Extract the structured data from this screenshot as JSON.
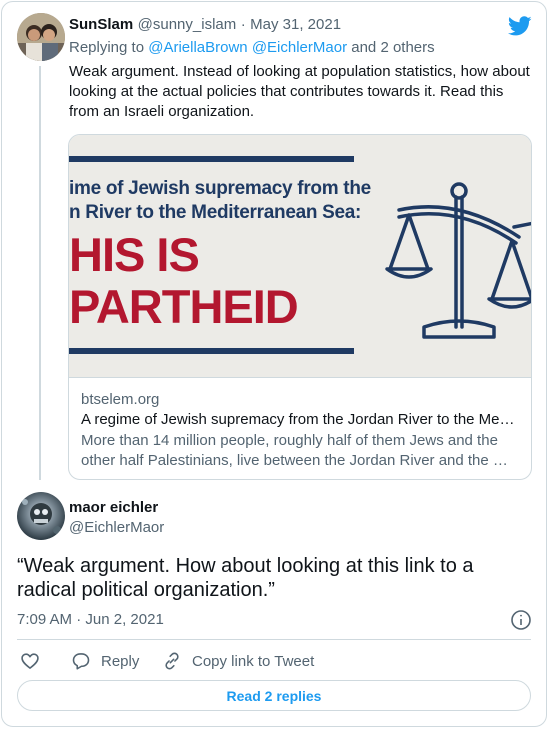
{
  "reply_tweet": {
    "display_name": "SunSlam",
    "handle": "@sunny_islam",
    "separator": "·",
    "date": "May 31, 2021",
    "replying_prefix": "Replying to",
    "replying_to": "@AriellaBrown @EichlerMaor",
    "replying_suffix": "and 2 others",
    "text": "Weak argument.   Instead of looking at population statistics, how about looking at the actual policies that contributes towards it.  Read this from an Israeli organization.",
    "link_card": {
      "image_line1": "ime of Jewish supremacy from the",
      "image_line2": "n River to the Mediterranean Sea:",
      "image_big1": "HIS IS",
      "image_big2": "PARTHEID",
      "domain": "btselem.org",
      "title": "A regime of Jewish supremacy from the Jordan River to the Me…",
      "description": "More than 14 million people, roughly half of them Jews and the other half Palestinians, live between the Jordan River and the …"
    }
  },
  "main_tweet": {
    "display_name": "maor eichler",
    "handle": "@EichlerMaor",
    "text": "“Weak argument. How about looking at this link to a radical political organization.”",
    "time": "7:09 AM",
    "separator": "·",
    "date": "Jun 2, 2021"
  },
  "actions": {
    "reply_label": "Reply",
    "copy_link_label": "Copy link to Tweet",
    "read_replies_label": "Read 2 replies"
  },
  "colors": {
    "accent": "#1d9bf0",
    "muted": "#536471",
    "border": "#cfd9de",
    "banner_red": "#b3172f",
    "banner_navy": "#1f3a63"
  },
  "icons": {
    "logo": "twitter-bird-icon",
    "info": "info-icon",
    "like": "heart-icon",
    "reply": "reply-bubble-icon",
    "copy": "link-icon",
    "scales": "scales-of-justice-icon"
  }
}
